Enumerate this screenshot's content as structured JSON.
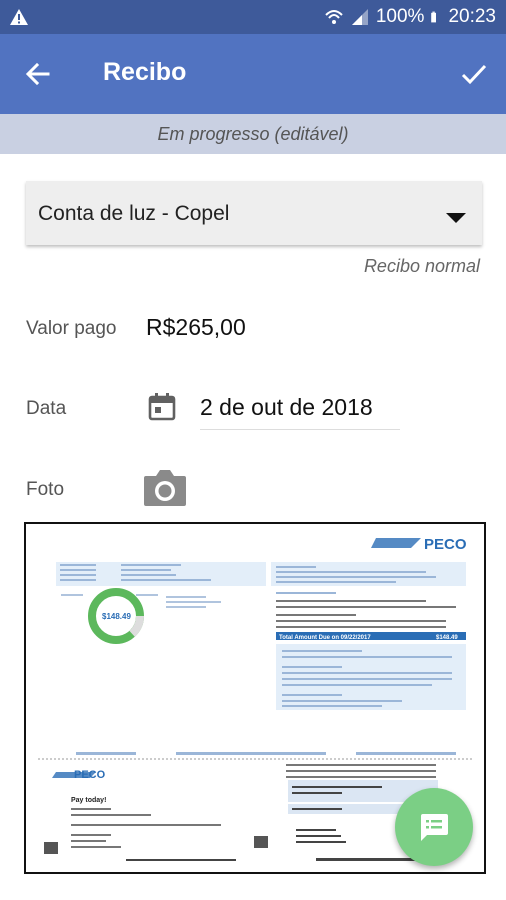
{
  "status_bar": {
    "battery": "100%",
    "time": "20:23"
  },
  "app_bar": {
    "title": "Recibo"
  },
  "banner": {
    "text": "Em progresso (editável)"
  },
  "category": {
    "selected": "Conta de luz - Copel",
    "type": "Recibo normal"
  },
  "amount": {
    "label": "Valor pago",
    "value": "R$265,00"
  },
  "date": {
    "label": "Data",
    "value": "2 de out de 2018"
  },
  "photo": {
    "label": "Foto"
  },
  "receipt_image": {
    "brand": "PECO",
    "amount_due": "$148.49",
    "total_label": "Total Amount Due on 09/22/2017",
    "total_value": "$148.49",
    "pay_today": "Pay today!"
  }
}
